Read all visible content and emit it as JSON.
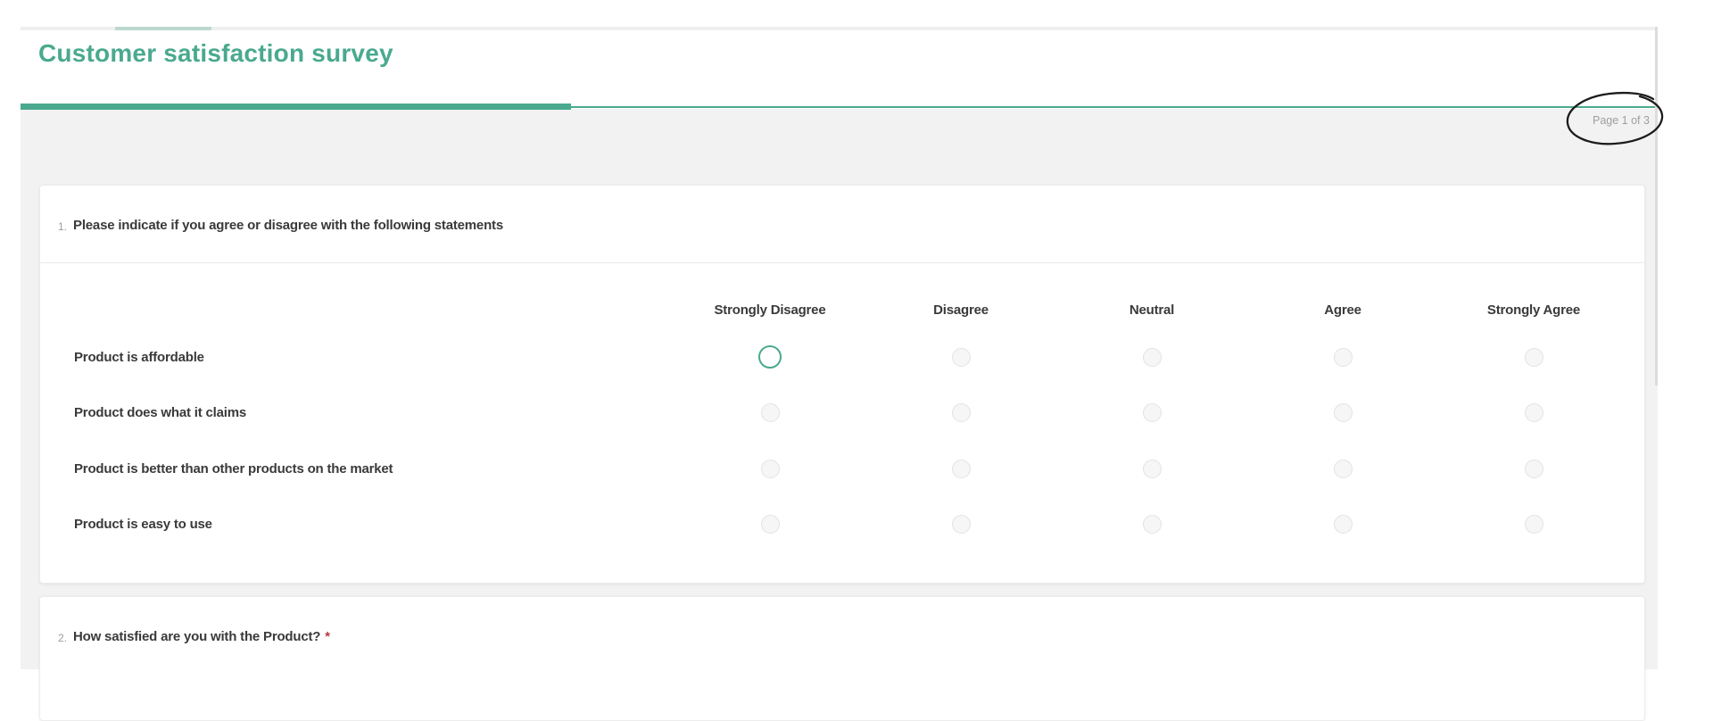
{
  "app": {
    "title": "Customer satisfaction survey",
    "page_indicator": "Page 1 of 3"
  },
  "colors": {
    "accent_teal": "#4aa98e",
    "accent_teal_light": "#bcd9cd",
    "page_background": "#f2f2f2",
    "text_dark": "#3a3a3a",
    "text_muted": "#9e9e9e",
    "required_red": "#b23c45",
    "annotation_ink": "#1c1c1c"
  },
  "question1": {
    "number": "1.",
    "text": "Please indicate if you agree or disagree with the following statements",
    "columns": [
      "Strongly Disagree",
      "Disagree",
      "Neutral",
      "Agree",
      "Strongly Agree"
    ],
    "rows": [
      "Product is affordable",
      "Product does what it claims",
      "Product is better than other products on the market",
      "Product is easy to use"
    ],
    "selection": {
      "row": 0,
      "column": 0,
      "state": "highlighted"
    }
  },
  "question2": {
    "number": "2.",
    "text": "How satisfied are you with the Product?",
    "required_marker": "*"
  }
}
